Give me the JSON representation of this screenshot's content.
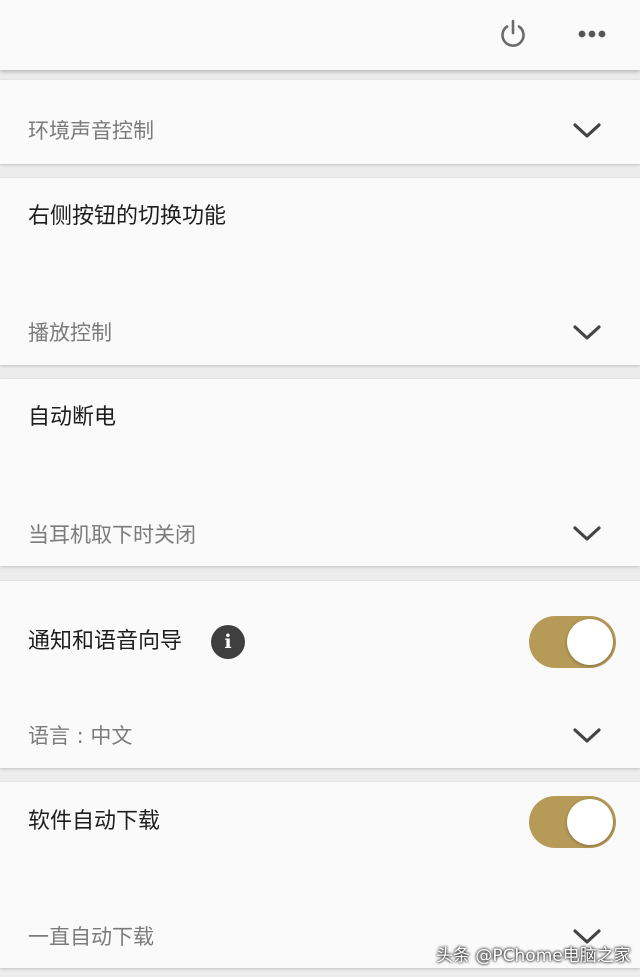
{
  "header": {
    "power_icon": "power-icon",
    "more_icon": "more-icon"
  },
  "sections": {
    "ambient": {
      "value": "环境声音控制"
    },
    "right_button": {
      "title": "右侧按钮的切换功能",
      "value": "播放控制"
    },
    "auto_off": {
      "title": "自动断电",
      "value": "当耳机取下时关闭"
    },
    "voice_guide": {
      "title": "通知和语音向导",
      "info_icon": "i",
      "enabled": true,
      "value": "语言 : 中文"
    },
    "auto_download": {
      "title": "软件自动下载",
      "enabled": true,
      "value": "一直自动下载"
    }
  },
  "watermark": "头条 @PChome电脑之家",
  "colors": {
    "accent": "#b69a57",
    "card": "#fafafa",
    "divider": "#ececec"
  }
}
